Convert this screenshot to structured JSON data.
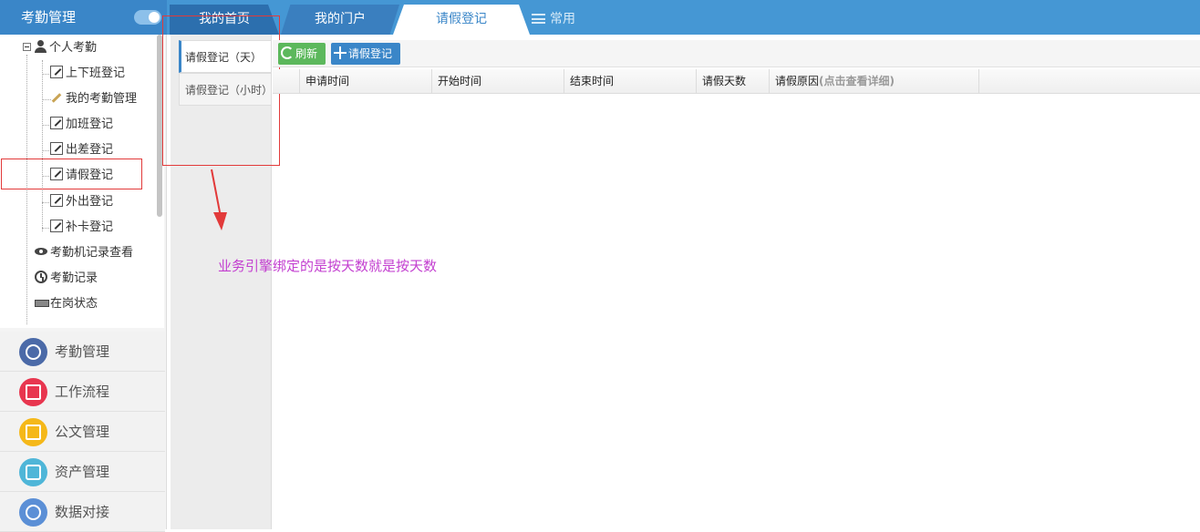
{
  "app": {
    "title": "考勤管理"
  },
  "tabs": {
    "home": "我的首页",
    "portal": "我的门户",
    "leave": "请假登记",
    "common": "常用"
  },
  "tree": {
    "group": "个人考勤",
    "items": [
      "上下班登记",
      "我的考勤管理",
      "加班登记",
      "出差登记",
      "请假登记",
      "外出登记",
      "补卡登记"
    ],
    "others": [
      "考勤机记录查看",
      "考勤记录",
      "在岗状态"
    ]
  },
  "modules": [
    {
      "label": "考勤管理",
      "color": "#4b6aa8"
    },
    {
      "label": "工作流程",
      "color": "#e8364f"
    },
    {
      "label": "公文管理",
      "color": "#f5b819"
    },
    {
      "label": "资产管理",
      "color": "#4fb6d8"
    },
    {
      "label": "数据对接",
      "color": "#5b8fd6"
    }
  ],
  "subtabs": {
    "day": "请假登记（天）",
    "hour": "请假登记（小时）"
  },
  "toolbar": {
    "refresh": "刷新",
    "add": "请假登记"
  },
  "grid": {
    "columns": [
      "申请时间",
      "开始时间",
      "结束时间",
      "请假天数",
      "请假原因"
    ],
    "reason_hint": "(点击查看详细)"
  },
  "annotation": {
    "note": "业务引擎绑定的是按天数就是按天数",
    "color": "#c33fd0"
  }
}
